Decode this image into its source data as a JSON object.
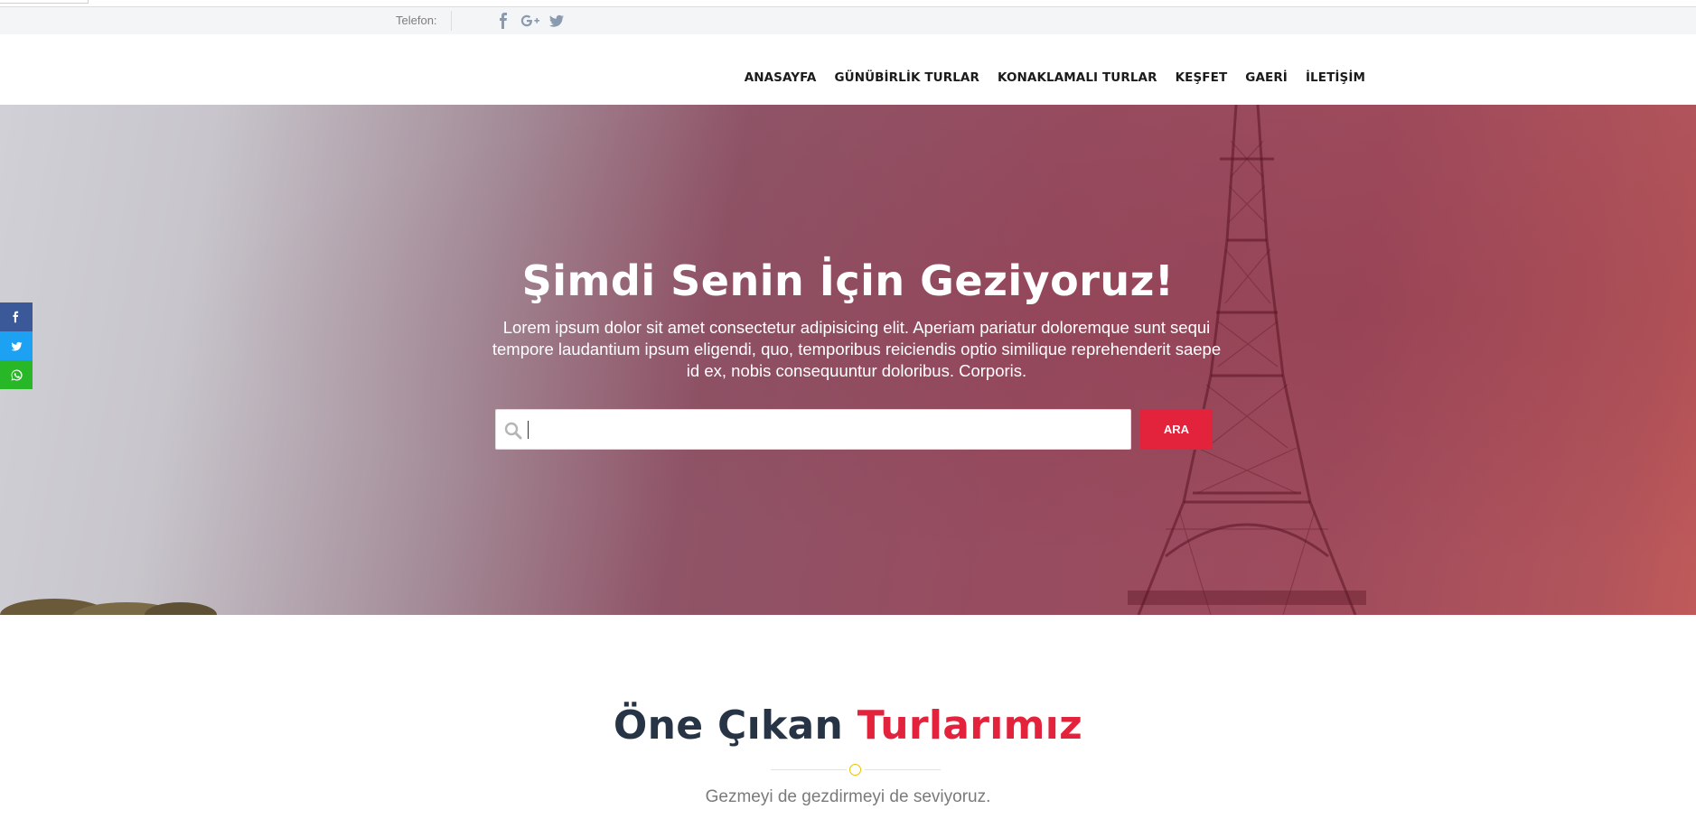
{
  "topbar": {
    "phone_label": "Telefon:",
    "social_icons": [
      "facebook-icon",
      "google-plus-icon",
      "twitter-icon"
    ]
  },
  "nav": {
    "items": [
      {
        "label": "ANASAYFA"
      },
      {
        "label": "GÜNÜBİRLİK TURLAR"
      },
      {
        "label": "KONAKLAMALI TURLAR"
      },
      {
        "label": "KEŞFET"
      },
      {
        "label": "GAERİ"
      },
      {
        "label": "İLETİŞİM"
      }
    ]
  },
  "hero": {
    "title": "Şimdi Senin İçin Geziyoruz!",
    "lead": "Lorem ipsum dolor sit amet consectetur adipisicing elit. Aperiam pariatur doloremque sunt sequi tempore laudantium ipsum eligendi, quo, temporibus reiciendis optio similique reprehenderit saepe id ex, nobis consequuntur doloribus. Corporis.",
    "search": {
      "value": "",
      "placeholder": ""
    },
    "search_button": "ARA"
  },
  "share_bar": {
    "icons": [
      "facebook-icon",
      "twitter-icon",
      "whatsapp-icon"
    ]
  },
  "featured": {
    "title_main": "Öne Çıkan",
    "title_accent": "Turlarımız",
    "subtitle": "Gezmeyi de gezdirmeyi de seviyoruz."
  },
  "colors": {
    "accent": "#e3223c",
    "heading": "#263445",
    "facebook": "#3b5998",
    "twitter": "#1da1f2",
    "whatsapp": "#27b727",
    "divider_dot": "#e8c200"
  }
}
